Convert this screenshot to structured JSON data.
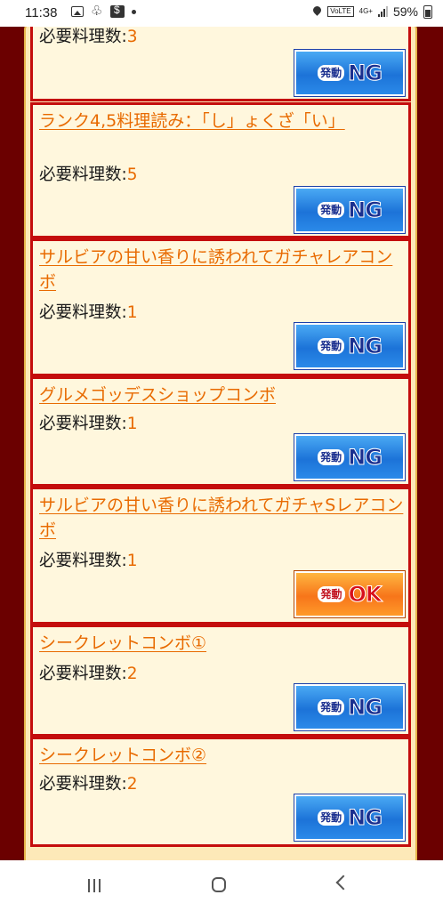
{
  "status_bar": {
    "time": "11:38",
    "network": "4G+",
    "volte": "VoLTE",
    "battery": "59%"
  },
  "combos": [
    {
      "title": "",
      "req_label": "必要料理数:",
      "req_value": "3",
      "status": "NG",
      "badge_kanji": "発動",
      "badge_word": "NG"
    },
    {
      "title": "ランク4,5料理読み：「し」ょくざ「い」",
      "req_label": "必要料理数:",
      "req_value": "5",
      "status": "NG",
      "badge_kanji": "発動",
      "badge_word": "NG"
    },
    {
      "title": "サルビアの甘い香りに誘われてガチャレアコンボ",
      "req_label": "必要料理数:",
      "req_value": "1",
      "status": "NG",
      "badge_kanji": "発動",
      "badge_word": "NG"
    },
    {
      "title": "グルメゴッデスショップコンボ",
      "req_label": "必要料理数:",
      "req_value": "1",
      "status": "NG",
      "badge_kanji": "発動",
      "badge_word": "NG"
    },
    {
      "title": "サルビアの甘い香りに誘われてガチャSレアコンボ",
      "req_label": "必要料理数:",
      "req_value": "1",
      "status": "OK",
      "badge_kanji": "発動",
      "badge_word": "OK"
    },
    {
      "title": "シークレットコンボ①",
      "req_label": "必要料理数:",
      "req_value": "2",
      "status": "NG",
      "badge_kanji": "発動",
      "badge_word": "NG"
    },
    {
      "title": "シークレットコンボ②",
      "req_label": "必要料理数:",
      "req_value": "2",
      "status": "NG",
      "badge_kanji": "発動",
      "badge_word": "NG"
    }
  ],
  "colors": {
    "background": "#6b0000",
    "card_border": "#c40d0d",
    "card_fill": "#fff7dd",
    "title_link": "#e86a00",
    "badge_ng": "#1c73d8",
    "badge_ok": "#f7751a"
  },
  "nav_icons": [
    "recent-apps-icon",
    "home-icon",
    "back-icon"
  ]
}
